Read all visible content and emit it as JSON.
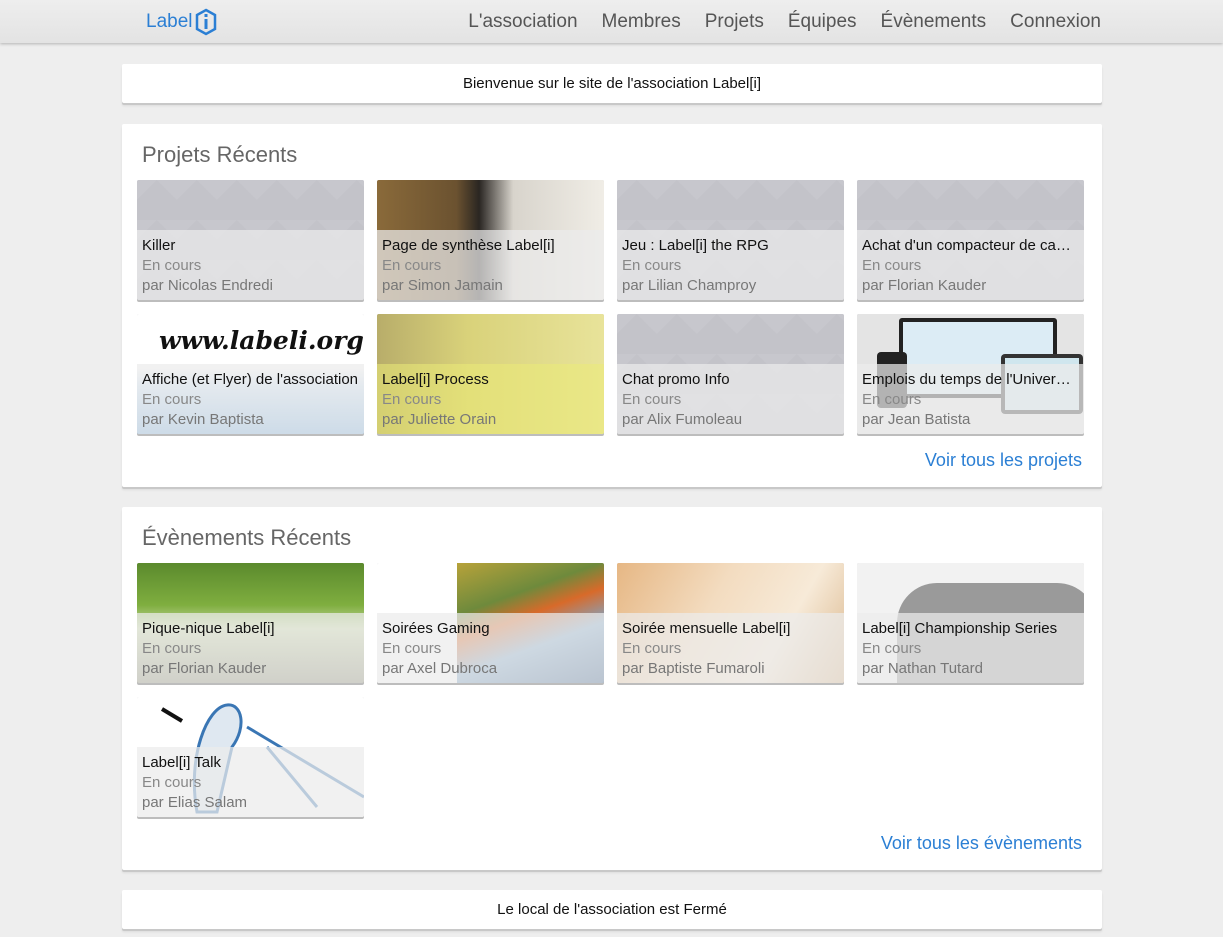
{
  "brand": {
    "name": "Label",
    "accent": "#2b7fd4"
  },
  "nav": {
    "items": [
      "L'association",
      "Membres",
      "Projets",
      "Équipes",
      "Évènements",
      "Connexion"
    ]
  },
  "welcome": {
    "text": "Bienvenue sur le site de l'association Label[i]"
  },
  "projects": {
    "title": "Projets Récents",
    "more": "Voir tous les projets",
    "items": [
      {
        "title": "Killer",
        "status": "En cours",
        "author": "par Nicolas Endredi"
      },
      {
        "title": "Page de synthèse Label[i]",
        "status": "En cours",
        "author": "par Simon Jamain"
      },
      {
        "title": "Jeu : Label[i] the RPG",
        "status": "En cours",
        "author": "par Lilian Champroy"
      },
      {
        "title": "Achat d'un compacteur de ca…",
        "status": "En cours",
        "author": "par Florian Kauder"
      },
      {
        "title": "Affiche (et Flyer) de l'association",
        "status": "En cours",
        "author": "par Kevin Baptista",
        "image_text": "www.labeli.org"
      },
      {
        "title": "Label[i] Process",
        "status": "En cours",
        "author": "par Juliette Orain"
      },
      {
        "title": "Chat promo Info",
        "status": "En cours",
        "author": "par Alix Fumoleau"
      },
      {
        "title": "Emplois du temps de l'Univer…",
        "status": "En cours",
        "author": "par Jean Batista"
      }
    ]
  },
  "events": {
    "title": "Évènements Récents",
    "more": "Voir tous les évènements",
    "items": [
      {
        "title": "Pique-nique Label[i]",
        "status": "En cours",
        "author": "par Florian Kauder"
      },
      {
        "title": "Soirées Gaming",
        "status": "En cours",
        "author": "par Axel Dubroca"
      },
      {
        "title": "Soirée mensuelle Label[i]",
        "status": "En cours",
        "author": "par Baptiste Fumaroli"
      },
      {
        "title": "Label[i] Championship Series",
        "status": "En cours",
        "author": "par Nathan Tutard"
      },
      {
        "title": "Label[i] Talk",
        "status": "En cours",
        "author": "par Elias Salam"
      }
    ]
  },
  "footer": {
    "text": "Le local de l'association est Fermé"
  }
}
